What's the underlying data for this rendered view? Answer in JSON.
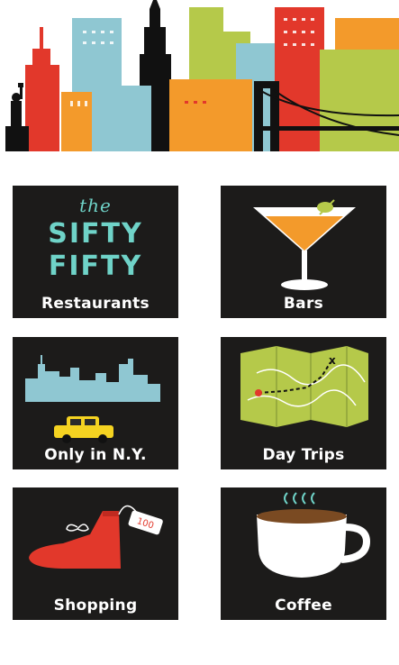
{
  "banner": {
    "icon": "nyc-skyline-illustration"
  },
  "tiles": [
    {
      "id": "restaurants",
      "label": "Restaurants",
      "icon": "sifty-fifty-logo",
      "logo": {
        "the": "the",
        "line1": "SIFTY",
        "line2": "FIFTY"
      }
    },
    {
      "id": "bars",
      "label": "Bars",
      "icon": "martini-glass-icon"
    },
    {
      "id": "only-ny",
      "label": "Only in N.Y.",
      "icon": "skyline-taxi-icon"
    },
    {
      "id": "day-trips",
      "label": "Day Trips",
      "icon": "map-icon"
    },
    {
      "id": "shopping",
      "label": "Shopping",
      "icon": "boot-shopping-tag-icon",
      "tag_text": "100"
    },
    {
      "id": "coffee",
      "label": "Coffee",
      "icon": "coffee-cup-icon"
    }
  ],
  "colors": {
    "tile_bg": "#1c1b1a",
    "teal": "#6fd3c8",
    "red": "#e2382b",
    "orange": "#f39a2b",
    "green": "#b5c94a",
    "yellow": "#f5d321",
    "sky_blue": "#8fc7d2"
  }
}
